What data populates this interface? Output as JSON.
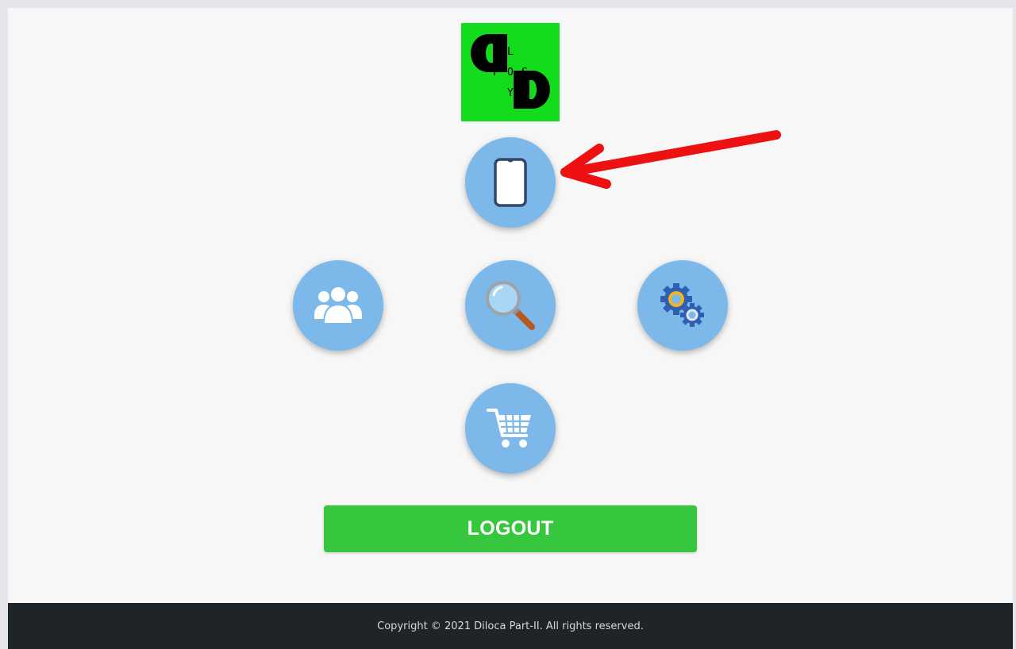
{
  "logo": {
    "letters": [
      "L",
      "P",
      "O",
      "S",
      "Y"
    ],
    "background_color": "#12dc1c"
  },
  "menu": {
    "buttons": [
      {
        "icon": "smartphone-icon"
      },
      {
        "icon": "users-icon"
      },
      {
        "icon": "search-icon"
      },
      {
        "icon": "gears-icon"
      },
      {
        "icon": "shopping-cart-icon"
      }
    ],
    "button_color": "#7cb8ea"
  },
  "logout": {
    "label": "LOGOUT",
    "color": "#37c73f"
  },
  "footer": {
    "text": "Copyright © 2021 Diloca Part-II. All rights reserved.",
    "background_color": "#1f2428"
  },
  "annotation": {
    "icon": "red-arrow-icon",
    "color": "#ee1111"
  }
}
